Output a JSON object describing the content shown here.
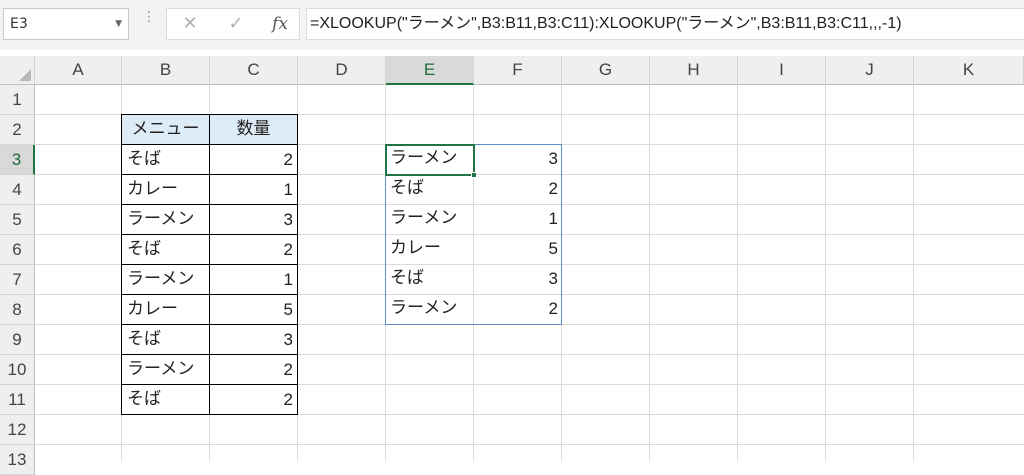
{
  "name_box": "E3",
  "formula_bar": {
    "cancel_icon": "x-icon",
    "enter_icon": "checkmark-icon",
    "function_icon": "fx-icon",
    "fx_label": "fx",
    "formula": "=XLOOKUP(\"ラーメン\",B3:B11,B3:C11):XLOOKUP(\"ラーメン\",B3:B11,B3:C11,,,-1)"
  },
  "columns": [
    "A",
    "B",
    "C",
    "D",
    "E",
    "F",
    "G",
    "H",
    "I",
    "J",
    "K"
  ],
  "rows": [
    "1",
    "2",
    "3",
    "4",
    "5",
    "6",
    "7",
    "8",
    "9",
    "10",
    "11",
    "12",
    "13"
  ],
  "selected_column": "E",
  "selected_row": "3",
  "source_table": {
    "headers": [
      "メニュー",
      "数量"
    ],
    "rows": [
      [
        "そば",
        "2"
      ],
      [
        "カレー",
        "1"
      ],
      [
        "ラーメン",
        "3"
      ],
      [
        "そば",
        "2"
      ],
      [
        "ラーメン",
        "1"
      ],
      [
        "カレー",
        "5"
      ],
      [
        "そば",
        "3"
      ],
      [
        "ラーメン",
        "2"
      ],
      [
        "そば",
        "2"
      ]
    ]
  },
  "spill_result": {
    "rows": [
      [
        "ラーメン",
        "3"
      ],
      [
        "そば",
        "2"
      ],
      [
        "ラーメン",
        "1"
      ],
      [
        "カレー",
        "5"
      ],
      [
        "そば",
        "3"
      ],
      [
        "ラーメン",
        "2"
      ]
    ]
  },
  "colors": {
    "header_fill": "#ddebf7",
    "selection": "#217346",
    "spill_border": "#5b8fd0"
  }
}
